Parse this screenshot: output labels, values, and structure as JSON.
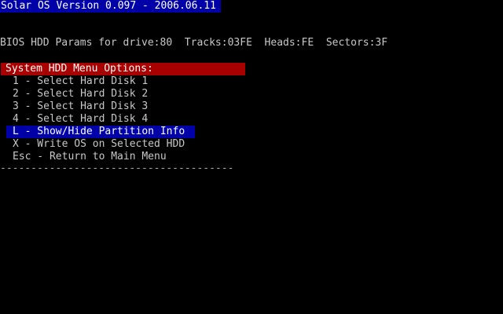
{
  "header": {
    "title": "Solar OS Version 0.097 - 2006.06.11"
  },
  "bios": {
    "params": "BIOS HDD Params for drive:80  Tracks:03FE  Heads:FE  Sectors:3F"
  },
  "menu": {
    "title": "System HDD Menu Options:",
    "items": [
      {
        "label": "1 - Select Hard Disk 1"
      },
      {
        "label": "2 - Select Hard Disk 2"
      },
      {
        "label": "3 - Select Hard Disk 3"
      },
      {
        "label": "4 - Select Hard Disk 4"
      },
      {
        "label": "L - Show/Hide Partition Info"
      },
      {
        "label": "X - Write OS on Selected HDD"
      },
      {
        "label": "Esc - Return to Main Menu"
      }
    ],
    "selected_index": 4,
    "separator": "--------------------------------------"
  },
  "colors": {
    "background": "#000000",
    "text": "#c8c8c8",
    "title_bg": "#0000a8",
    "header_bg": "#a80000",
    "selection_bg": "#0000a8"
  }
}
